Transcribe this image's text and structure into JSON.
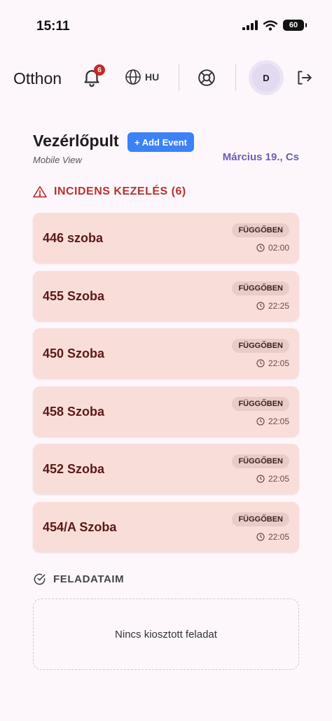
{
  "status_bar": {
    "time": "15:11",
    "battery": "60"
  },
  "header": {
    "app_title": "Otthon",
    "notification_count": "6",
    "language": "HU",
    "avatar_initial": "D"
  },
  "dashboard": {
    "title": "Vezérlőpult",
    "add_event_label": "+ Add Event",
    "subtitle": "Mobile View",
    "date": "Március 19., Cs"
  },
  "incidents": {
    "title": "INCIDENS KEZELÉS (6)",
    "items": [
      {
        "room": "446 szoba",
        "status": "FÜGGŐBEN",
        "time": "02:00"
      },
      {
        "room": "455 Szoba",
        "status": "FÜGGŐBEN",
        "time": "22:25"
      },
      {
        "room": "450 Szoba",
        "status": "FÜGGŐBEN",
        "time": "22:05"
      },
      {
        "room": "458 Szoba",
        "status": "FÜGGŐBEN",
        "time": "22:05"
      },
      {
        "room": "452 Szoba",
        "status": "FÜGGŐBEN",
        "time": "22:05"
      },
      {
        "room": "454/A Szoba",
        "status": "FÜGGŐBEN",
        "time": "22:05"
      }
    ]
  },
  "tasks": {
    "title": "FELADATAIM",
    "empty_text": "Nincs kiosztott feladat"
  },
  "colors": {
    "accent_blue": "#3b82f6",
    "incident_red": "#b8312f",
    "card_bg": "#f9ddd9",
    "date_purple": "#6a5fb0"
  },
  "icons": [
    "bell-icon",
    "globe-icon",
    "lifebuoy-icon",
    "logout-icon",
    "warning-icon",
    "clock-icon",
    "check-circle-icon",
    "signal-icon",
    "wifi-icon",
    "battery-icon"
  ]
}
